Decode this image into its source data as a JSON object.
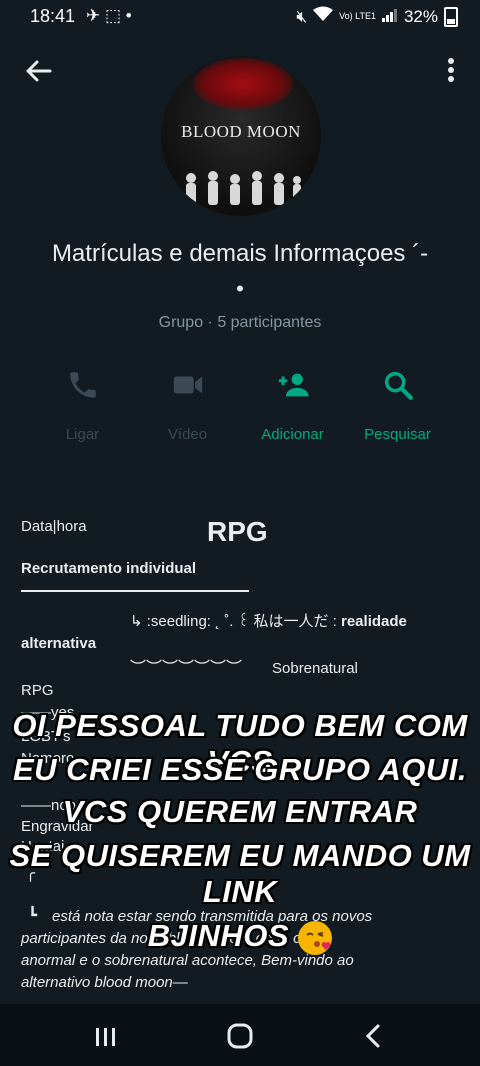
{
  "status_bar": {
    "time": "18:41",
    "left_icons": "✈ ⬚ •",
    "network": "Vo) LTE1",
    "battery": "32%"
  },
  "group": {
    "avatar_text": "BLOOD MOON",
    "title": "Matrículas e demais Informaçoes ´-",
    "title_dot": "•",
    "subtitle": "Grupo · 5 participantes"
  },
  "actions": [
    {
      "label": "Ligar",
      "icon": "phone-icon"
    },
    {
      "label": "Vídeo",
      "icon": "video-icon"
    },
    {
      "label": "Adicionar",
      "icon": "add-person-icon"
    },
    {
      "label": "Pesquisar",
      "icon": "search-icon"
    }
  ],
  "description": {
    "data_hora": "Data|hora",
    "heading": "RPG",
    "recruit": "Recrutamento individual",
    "seedling_line": "↳ :seedling: ˛ ˚. ꒰ 私は一人だ : ",
    "seedling_bold": "realidade",
    "alternativa": "alternativa",
    "wave": "︶︶︶︶︶︶︶",
    "sobrenatural": "Sobrenatural",
    "rpg": "RPG",
    "dash1": "——yes",
    "lgbt": "LGBT's",
    "namoro": "Namoro",
    "nop": "——nop",
    "engravidar": "Engravidar",
    "hentai": "Hentai",
    "corner": "╭",
    "arrow": "┗",
    "para1": "está nota estar sendo transmitida para os novos",
    "para2": "participantes da noite blood moon\" onde o",
    "para3": "anormal e o sobrenatural acontece, Bem-vindo ao",
    "para4": "alternativo blood moon—"
  },
  "overlay": {
    "line1": "OI PESSOAL TUDO BEM COM VCS",
    "line2": "EU CRIEI ESSE GRUPO AQUI.",
    "line3": "VCS QUEREM ENTRAR",
    "line4": "SE QUISEREM EU MANDO UM LINK",
    "line5": "BJINHOS"
  },
  "colors": {
    "accent": "#00a884",
    "background": "#111b21",
    "dim": "#3b4a54"
  }
}
